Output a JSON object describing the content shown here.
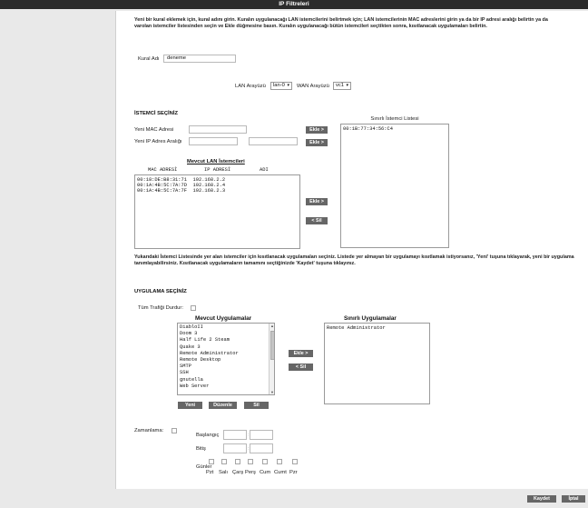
{
  "window": {
    "title": "IP Filtreleri"
  },
  "intro": "Yeni bir kural eklemek için, kural adını girin. Kuralın uygulanacağı LAN istemcilerini belirtmek için; LAN istemcilerinin MAC adreslerini girin ya da bir IP adresi aralığı belirtin ya da varolan istemciler listesinden seçin ve Ekle düğmesine basın. Kuralın uygulanacağı bütün istemcileri seçtikten sonra, kısıtlanacak uygulamaları belirtin.",
  "rule": {
    "label": "Kural Adı",
    "value": "deneme"
  },
  "lan": {
    "label": "LAN Arayüzü",
    "value": "lan-0"
  },
  "wan": {
    "label": "WAN Arayüzü",
    "value": "vc1"
  },
  "client_section": {
    "title": "İSTEMCİ SEÇİNİZ",
    "mac_label": "Yeni MAC Adresi",
    "ip_label": "Yeni IP Adres Aralığı",
    "add_label": "Ekle >",
    "add2_label": "Ekle >",
    "restricted_title": "Sınırlı İstemci Listesi",
    "restricted_items": [
      "00:1B:77:34:56:C4"
    ]
  },
  "current_lan": {
    "title": "Mevcut LAN İstemcileri",
    "col_mac": "MAC ADRESİ",
    "col_ip": "IP ADRESİ",
    "col_name": "ADI",
    "rows": [
      {
        "mac": "00:18:DE:B8:31:71",
        "ip": "192.168.2.2"
      },
      {
        "mac": "00:1A:4B:5C:7A:7D",
        "ip": "192.168.2.4"
      },
      {
        "mac": "00:1A:4B:5C:7A:7F",
        "ip": "192.168.2.3"
      }
    ],
    "add_label": "Ekle >",
    "del_label": "< Sil"
  },
  "app_intro": "Yukarıdaki İstemci Listesinde yer alan istemciler için kısıtlanacak uygulamaları seçiniz. Listede yer almayan bir uygulamayı kısıtlamak istiyorsanız, 'Yeni' tuşuna tıklayarak, yeni bir uygulama tanımlayabilirsiniz. Kısıtlanacak uygulamaların tamamını seçtiğinizde 'Kaydet' tuşuna tıklayınız.",
  "app_section": {
    "title": "UYGULAMA SEÇİNİZ",
    "stop_all_label": "Tüm Trafiği Durdur:",
    "current_title": "Mevcut Uygulamalar",
    "current_items": [
      "DiabloII",
      "Doom 3",
      "Half Life 2 Steam",
      "Quake 3",
      "Remote Administrator",
      "Remote Desktop",
      "SMTP",
      "SSH",
      "gnutella",
      "Web Server"
    ],
    "restricted_title": "Sınırlı Uygulamalar",
    "restricted_items": [
      "Remote Administrator"
    ],
    "add_label": "Ekle >",
    "del_label": "< Sil",
    "new_label": "Yeni",
    "edit_label": "Düzenle",
    "delete_label": "Sil"
  },
  "schedule": {
    "label": "Zamanlama:",
    "start_label": "Başlangıç",
    "end_label": "Bitiş",
    "days_label": "Günler",
    "days": [
      "Pzt",
      "Salı",
      "Çarş",
      "Perş",
      "Cum",
      "Cumt",
      "Pzr"
    ]
  },
  "footer": {
    "save_label": "Kaydet",
    "cancel_label": "İptal"
  }
}
